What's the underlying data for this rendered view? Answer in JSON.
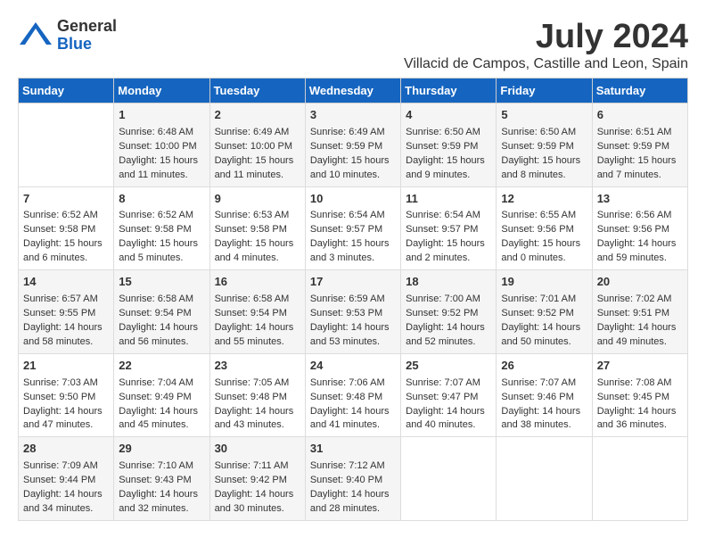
{
  "header": {
    "logo_general": "General",
    "logo_blue": "Blue",
    "month": "July 2024",
    "location": "Villacid de Campos, Castille and Leon, Spain"
  },
  "weekdays": [
    "Sunday",
    "Monday",
    "Tuesday",
    "Wednesday",
    "Thursday",
    "Friday",
    "Saturday"
  ],
  "weeks": [
    [
      {
        "day": "",
        "content": ""
      },
      {
        "day": "1",
        "content": "Sunrise: 6:48 AM\nSunset: 10:00 PM\nDaylight: 15 hours\nand 11 minutes."
      },
      {
        "day": "2",
        "content": "Sunrise: 6:49 AM\nSunset: 10:00 PM\nDaylight: 15 hours\nand 11 minutes."
      },
      {
        "day": "3",
        "content": "Sunrise: 6:49 AM\nSunset: 9:59 PM\nDaylight: 15 hours\nand 10 minutes."
      },
      {
        "day": "4",
        "content": "Sunrise: 6:50 AM\nSunset: 9:59 PM\nDaylight: 15 hours\nand 9 minutes."
      },
      {
        "day": "5",
        "content": "Sunrise: 6:50 AM\nSunset: 9:59 PM\nDaylight: 15 hours\nand 8 minutes."
      },
      {
        "day": "6",
        "content": "Sunrise: 6:51 AM\nSunset: 9:59 PM\nDaylight: 15 hours\nand 7 minutes."
      }
    ],
    [
      {
        "day": "7",
        "content": "Sunrise: 6:52 AM\nSunset: 9:58 PM\nDaylight: 15 hours\nand 6 minutes."
      },
      {
        "day": "8",
        "content": "Sunrise: 6:52 AM\nSunset: 9:58 PM\nDaylight: 15 hours\nand 5 minutes."
      },
      {
        "day": "9",
        "content": "Sunrise: 6:53 AM\nSunset: 9:58 PM\nDaylight: 15 hours\nand 4 minutes."
      },
      {
        "day": "10",
        "content": "Sunrise: 6:54 AM\nSunset: 9:57 PM\nDaylight: 15 hours\nand 3 minutes."
      },
      {
        "day": "11",
        "content": "Sunrise: 6:54 AM\nSunset: 9:57 PM\nDaylight: 15 hours\nand 2 minutes."
      },
      {
        "day": "12",
        "content": "Sunrise: 6:55 AM\nSunset: 9:56 PM\nDaylight: 15 hours\nand 0 minutes."
      },
      {
        "day": "13",
        "content": "Sunrise: 6:56 AM\nSunset: 9:56 PM\nDaylight: 14 hours\nand 59 minutes."
      }
    ],
    [
      {
        "day": "14",
        "content": "Sunrise: 6:57 AM\nSunset: 9:55 PM\nDaylight: 14 hours\nand 58 minutes."
      },
      {
        "day": "15",
        "content": "Sunrise: 6:58 AM\nSunset: 9:54 PM\nDaylight: 14 hours\nand 56 minutes."
      },
      {
        "day": "16",
        "content": "Sunrise: 6:58 AM\nSunset: 9:54 PM\nDaylight: 14 hours\nand 55 minutes."
      },
      {
        "day": "17",
        "content": "Sunrise: 6:59 AM\nSunset: 9:53 PM\nDaylight: 14 hours\nand 53 minutes."
      },
      {
        "day": "18",
        "content": "Sunrise: 7:00 AM\nSunset: 9:52 PM\nDaylight: 14 hours\nand 52 minutes."
      },
      {
        "day": "19",
        "content": "Sunrise: 7:01 AM\nSunset: 9:52 PM\nDaylight: 14 hours\nand 50 minutes."
      },
      {
        "day": "20",
        "content": "Sunrise: 7:02 AM\nSunset: 9:51 PM\nDaylight: 14 hours\nand 49 minutes."
      }
    ],
    [
      {
        "day": "21",
        "content": "Sunrise: 7:03 AM\nSunset: 9:50 PM\nDaylight: 14 hours\nand 47 minutes."
      },
      {
        "day": "22",
        "content": "Sunrise: 7:04 AM\nSunset: 9:49 PM\nDaylight: 14 hours\nand 45 minutes."
      },
      {
        "day": "23",
        "content": "Sunrise: 7:05 AM\nSunset: 9:48 PM\nDaylight: 14 hours\nand 43 minutes."
      },
      {
        "day": "24",
        "content": "Sunrise: 7:06 AM\nSunset: 9:48 PM\nDaylight: 14 hours\nand 41 minutes."
      },
      {
        "day": "25",
        "content": "Sunrise: 7:07 AM\nSunset: 9:47 PM\nDaylight: 14 hours\nand 40 minutes."
      },
      {
        "day": "26",
        "content": "Sunrise: 7:07 AM\nSunset: 9:46 PM\nDaylight: 14 hours\nand 38 minutes."
      },
      {
        "day": "27",
        "content": "Sunrise: 7:08 AM\nSunset: 9:45 PM\nDaylight: 14 hours\nand 36 minutes."
      }
    ],
    [
      {
        "day": "28",
        "content": "Sunrise: 7:09 AM\nSunset: 9:44 PM\nDaylight: 14 hours\nand 34 minutes."
      },
      {
        "day": "29",
        "content": "Sunrise: 7:10 AM\nSunset: 9:43 PM\nDaylight: 14 hours\nand 32 minutes."
      },
      {
        "day": "30",
        "content": "Sunrise: 7:11 AM\nSunset: 9:42 PM\nDaylight: 14 hours\nand 30 minutes."
      },
      {
        "day": "31",
        "content": "Sunrise: 7:12 AM\nSunset: 9:40 PM\nDaylight: 14 hours\nand 28 minutes."
      },
      {
        "day": "",
        "content": ""
      },
      {
        "day": "",
        "content": ""
      },
      {
        "day": "",
        "content": ""
      }
    ]
  ]
}
